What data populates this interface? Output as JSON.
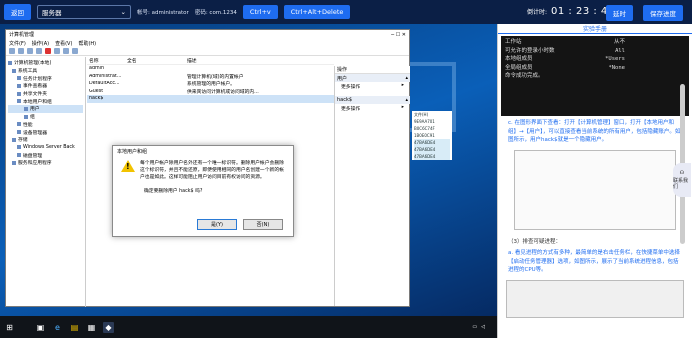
{
  "topbar": {
    "back_label": "返回",
    "server_select": "服务器",
    "account_label": "帐号: administrator",
    "password_label": "密码: com.1234",
    "ctrl_v_label": "Ctrl+v",
    "ctrl_alt_del_label": "Ctrl+Alt+Delete",
    "timer_label": "倒计时:",
    "timer_value": "01 : 23 : 49",
    "extend_label": "延时",
    "save_label": "保存进度"
  },
  "computer_mgmt": {
    "title": "计算机管理",
    "menu": [
      "文件(F)",
      "操作(A)",
      "查看(V)",
      "帮助(H)"
    ],
    "tree": [
      "计算机管理(本地)",
      "系统工具",
      "任务计划程序",
      "事件查看器",
      "共享文件夹",
      "本地用户和组",
      "用户",
      "组",
      "性能",
      "设备管理器",
      "存储",
      "Windows Server Back",
      "磁盘管理",
      "服务和应用程序"
    ],
    "columns": [
      "名称",
      "全名",
      "描述"
    ],
    "rows": [
      {
        "name": "admin",
        "fullname": "",
        "desc": ""
      },
      {
        "name": "Administrat...",
        "fullname": "",
        "desc": "管理计算机(域)的内置帐户"
      },
      {
        "name": "DefaultAcc...",
        "fullname": "",
        "desc": "系统管理的用户帐户。"
      },
      {
        "name": "Guest",
        "fullname": "",
        "desc": "供来宾访问计算机或访问域的内..."
      },
      {
        "name": "hack$",
        "fullname": "",
        "desc": ""
      }
    ],
    "actions_header": "操作",
    "actions": [
      {
        "group": "用户",
        "item": "更多操作"
      },
      {
        "group": "hack$",
        "item": "更多操作"
      }
    ],
    "side_codes": [
      "文件(H)",
      "9E9AA701",
      "B0C6C74F",
      "1B0E0C91",
      "47BA6DE4",
      "47BA6DE4",
      "47BA6DE4"
    ]
  },
  "dialog": {
    "title": "本地用户和组",
    "message": "每个用户帐户除用户名外还有一个唯一标识符。删除用户帐户会删除这个标识符，并且不能还原，即便使用相同的用户名创建一个新的帐户也是如此。这样可能阻止用户访问目前有权访问的资源。",
    "question": "确定要删除用户 hack$ 吗?",
    "yes_label": "是(Y)",
    "no_label": "否(N)"
  },
  "taskbar": {
    "time": "",
    "date": ""
  },
  "manual": {
    "tab_label": "实验手册",
    "terminal_lines": [
      {
        "k": "工作站",
        "v": "从不"
      },
      {
        "k": "可允许的登录小时数",
        "v": "All"
      },
      {
        "k": "",
        "v": ""
      },
      {
        "k": "本地组成员",
        "v": "*Users"
      },
      {
        "k": "全局组成员",
        "v": "*None"
      },
      {
        "k": "命令成功完成。",
        "v": ""
      }
    ],
    "para1": "c. 在图形界面下查看：打开【计算机管理】窗口，打开【本地用户和组】→【用户】，可以直接查看当前系统的所有用户，包括隐藏账户。如图所示，用户hack$就是一个隐藏用户。",
    "para2": "（3）排查可疑进程：",
    "para3": "a. 看见进程的方式有多种，最简单的是右击任务栏，在快捷菜单中选择【启动任务管理器】选项，如图所示，展示了当前系统进程信息，包括进程的CPU等。",
    "side_button": "联系我们"
  }
}
